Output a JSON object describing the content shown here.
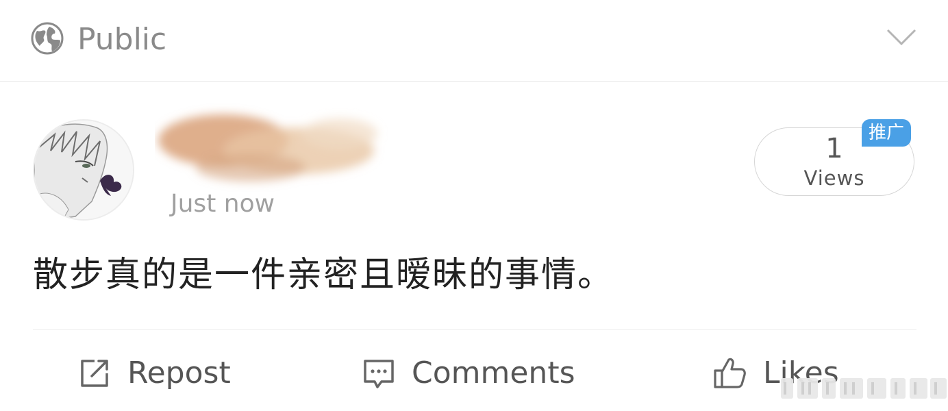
{
  "visibility": {
    "label": "Public",
    "icon": "globe-icon",
    "dropdown_icon": "chevron-down-icon"
  },
  "post": {
    "author_name": "",
    "timestamp": "Just now",
    "views": {
      "count": "1",
      "label": "Views"
    },
    "badge": "推广",
    "text": "散步真的是一件亲密且暧昧的事情。"
  },
  "actions": {
    "repost": "Repost",
    "comments": "Comments",
    "likes": "Likes"
  },
  "colors": {
    "badge_bg": "#4aa0e6",
    "muted_text": "#8a8a8a",
    "body_text": "#222222"
  }
}
